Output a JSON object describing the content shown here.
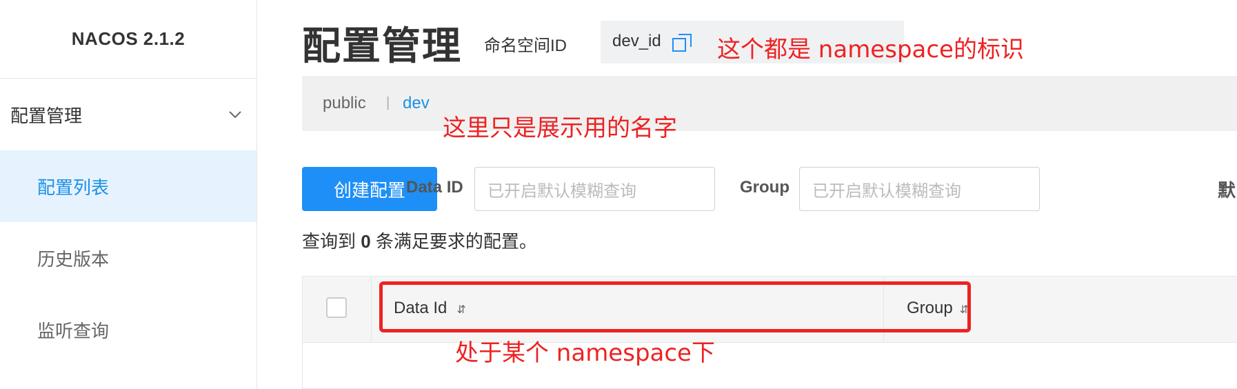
{
  "sidebar": {
    "brand": "NACOS 2.1.2",
    "group_label": "配置管理",
    "items": [
      {
        "label": "配置列表",
        "active": true
      },
      {
        "label": "历史版本",
        "active": false
      },
      {
        "label": "监听查询",
        "active": false
      }
    ]
  },
  "header": {
    "title": "配置管理",
    "namespace_label": "命名空间ID",
    "namespace_id": "dev_id",
    "copy_icon": "copy-icon"
  },
  "breadcrumb": {
    "items": [
      "public",
      "dev"
    ],
    "separator": "|"
  },
  "toolbar": {
    "create_label": "创建配置",
    "data_id_label": "Data ID",
    "data_id_placeholder": "已开启默认模糊查询",
    "group_label": "Group",
    "group_placeholder": "已开启默认模糊查询",
    "cut_label": "默"
  },
  "result": {
    "prefix": "查询到 ",
    "count": "0",
    "suffix": " 条满足要求的配置。"
  },
  "table": {
    "columns": [
      "Data Id",
      "Group"
    ],
    "sort_icon": "⇵"
  },
  "annotations": {
    "namespace_note": "这个都是 namespace的标识",
    "display_name_note": "这里只是展示用的名字",
    "under_namespace_note": "处于某个 namespace下",
    "accent_color": "#ee2222"
  },
  "colors": {
    "primary": "#1e8ff7",
    "active_bg": "#e6f3fe",
    "active_text": "#1b90e8"
  }
}
